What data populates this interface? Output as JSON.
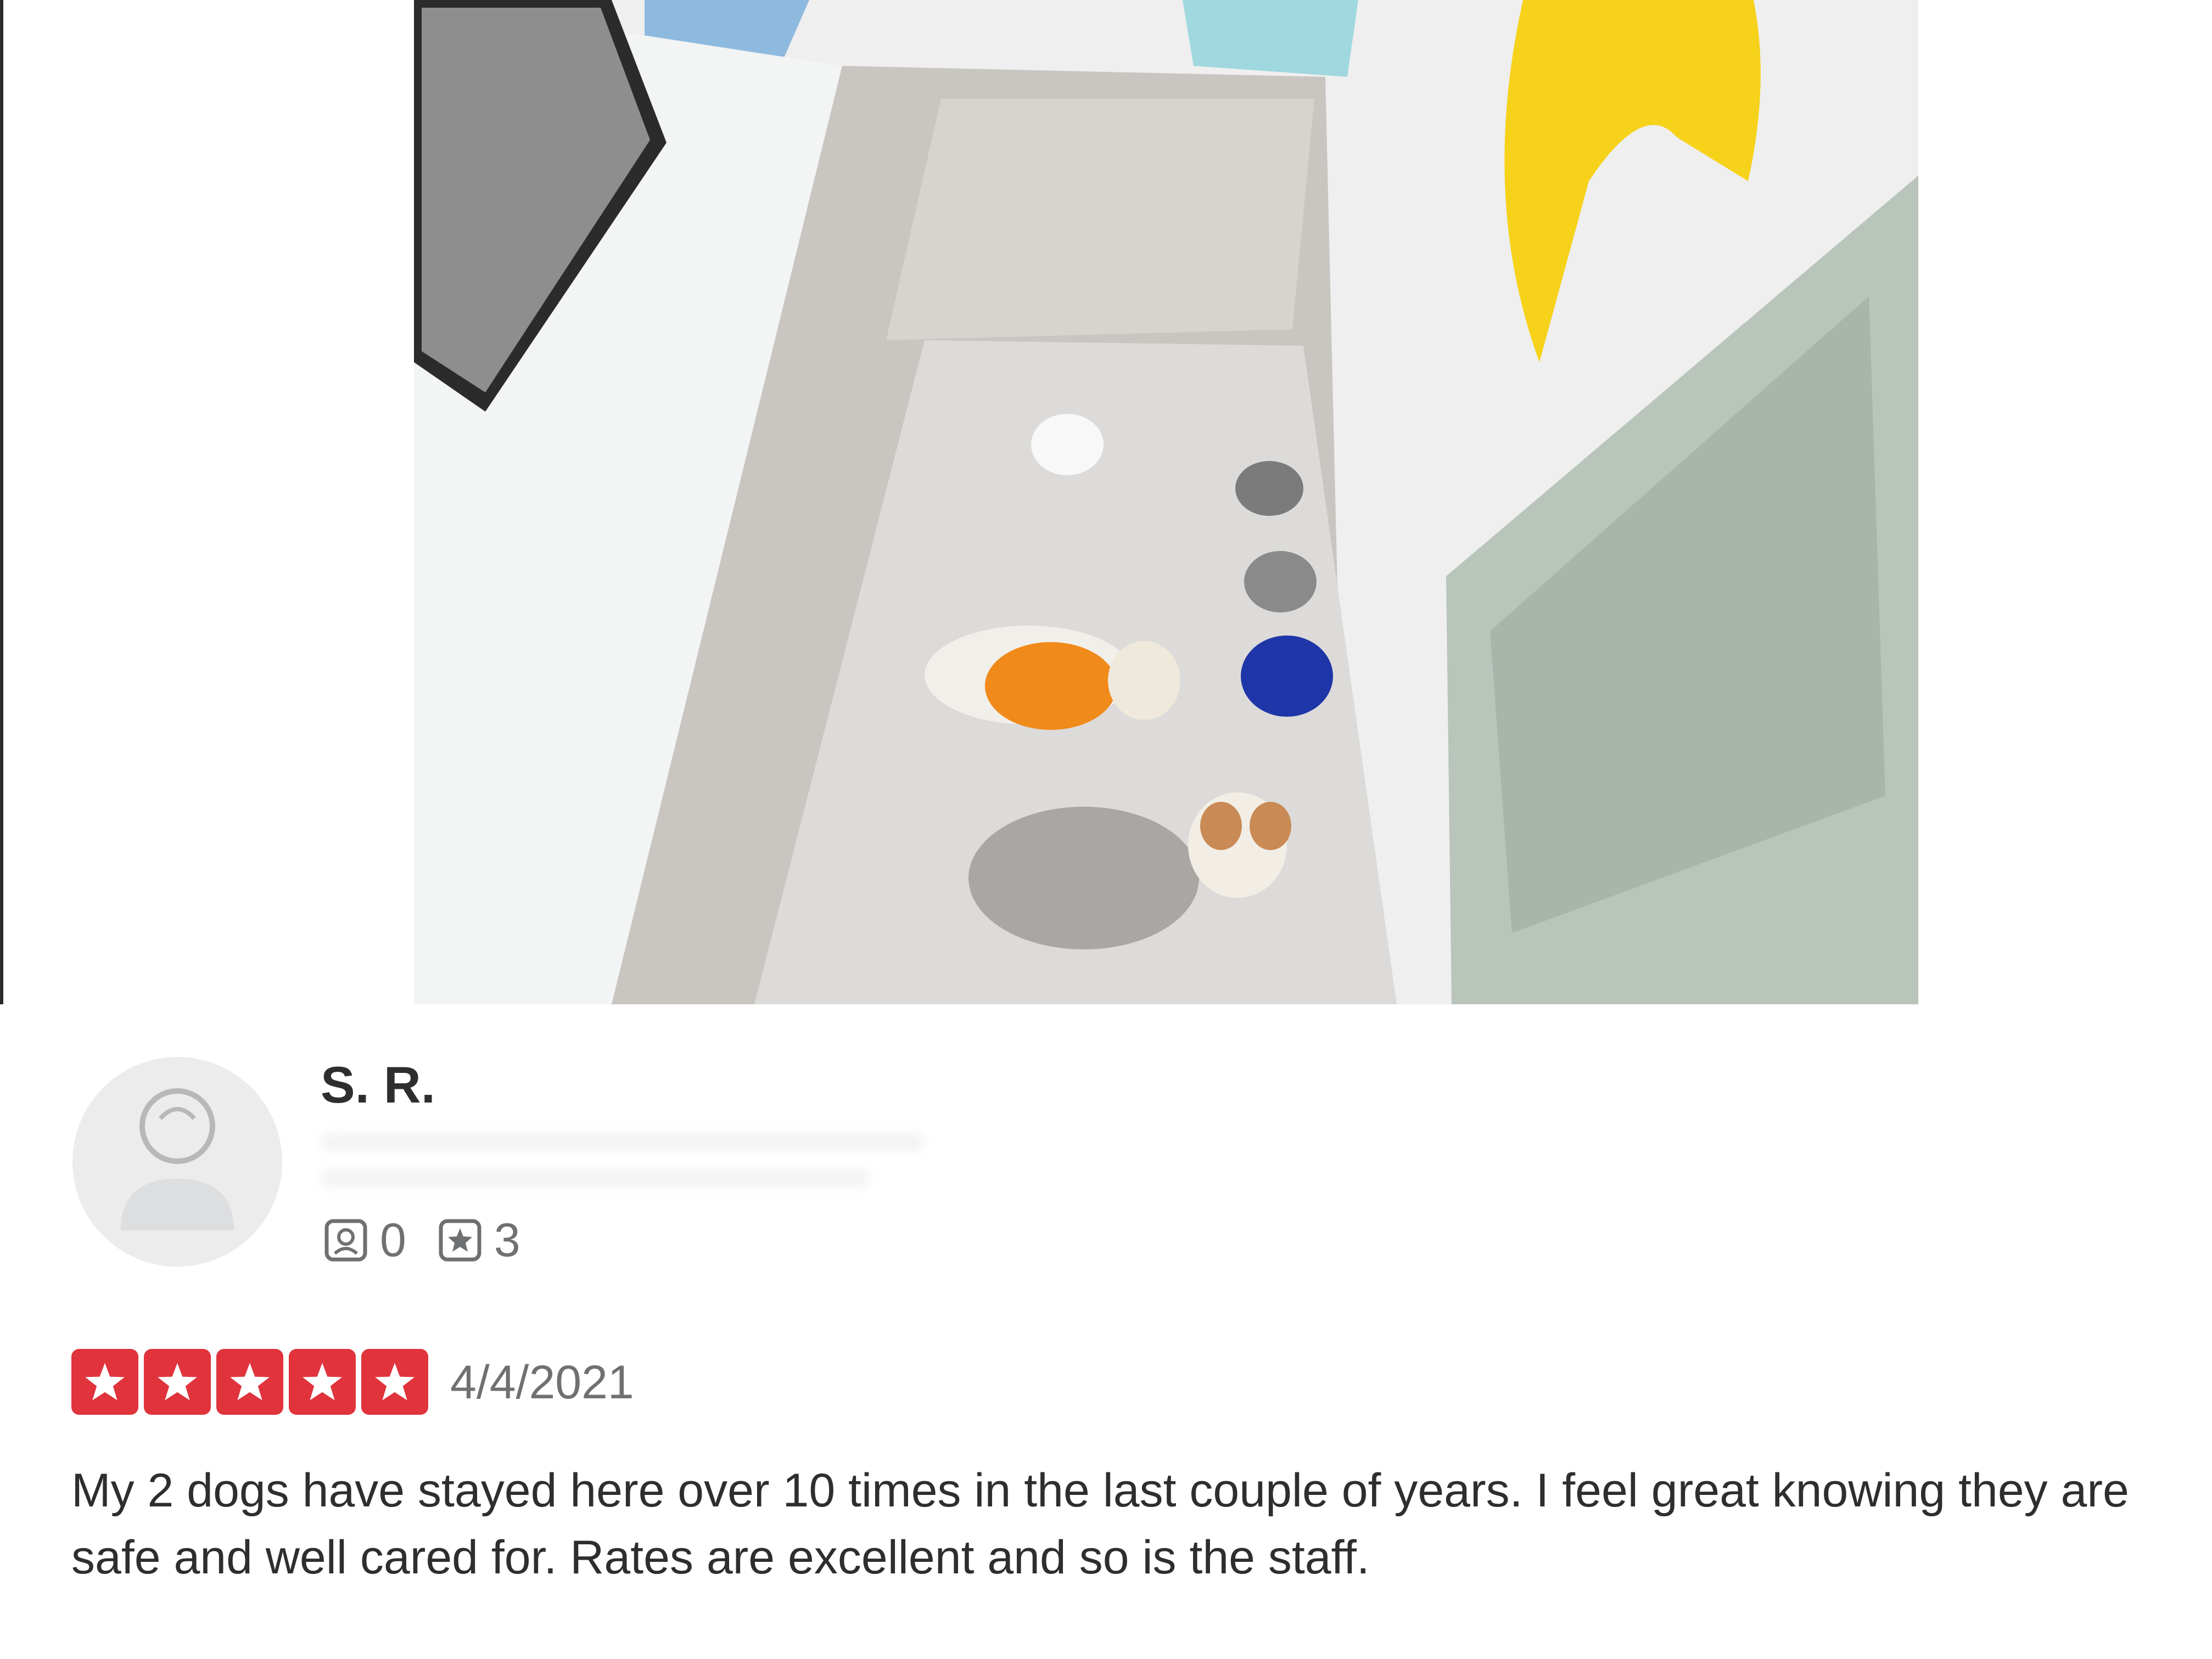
{
  "photo": {
    "alt": ""
  },
  "reviewer": {
    "avatar_icon": "default-user-icon",
    "name": "S. R.",
    "friends_icon": "friends-icon",
    "friends_count": "0",
    "reviews_icon": "reviews-icon",
    "reviews_count": "3"
  },
  "review": {
    "rating": 5,
    "rating_max": 5,
    "star_icon": "star-icon",
    "star_color": "#e0333c",
    "date": "4/4/2021",
    "text": "My 2 dogs have stayed here over 10 times in the last couple of years. I feel great knowing they are safe and well cared for. Rates are excellent and so is the staff."
  }
}
